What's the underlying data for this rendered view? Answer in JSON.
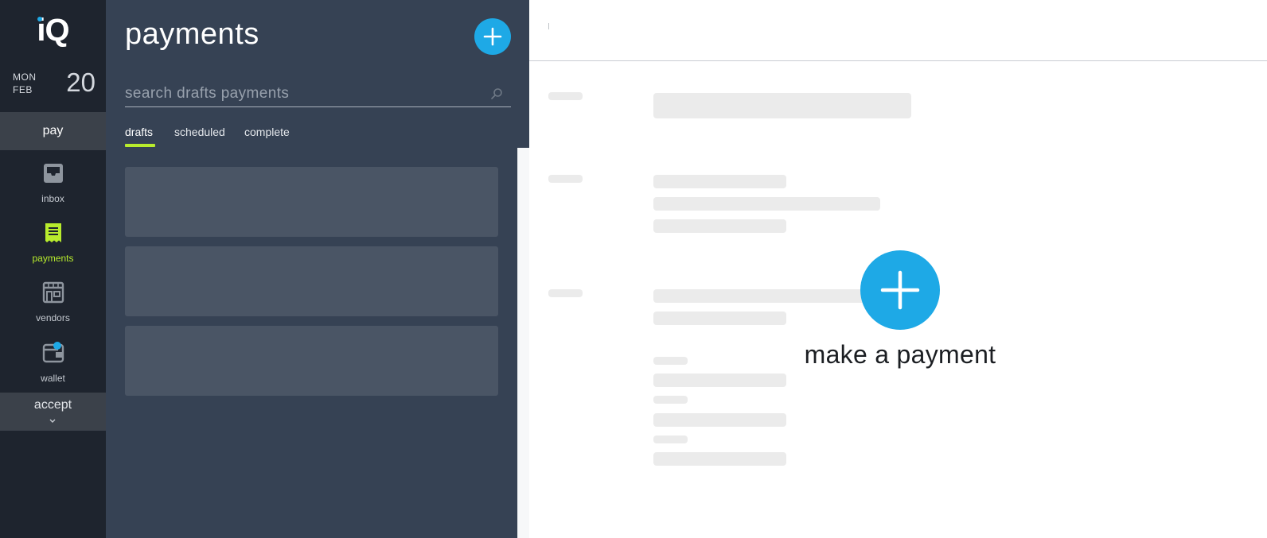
{
  "app": {
    "logo_text": "iQ",
    "date": {
      "weekday": "MON",
      "month": "FEB",
      "day": "20"
    }
  },
  "nav": {
    "pay_section_label": "pay",
    "items": [
      {
        "label": "inbox",
        "icon": "inbox-icon"
      },
      {
        "label": "payments",
        "icon": "receipt-icon",
        "active": true
      },
      {
        "label": "vendors",
        "icon": "storefront-icon"
      },
      {
        "label": "wallet",
        "icon": "wallet-icon"
      }
    ],
    "accept_section_label": "accept"
  },
  "list_panel": {
    "title": "payments",
    "search_placeholder": "search drafts payments",
    "tabs": [
      {
        "label": "drafts",
        "active": true
      },
      {
        "label": "scheduled"
      },
      {
        "label": "complete"
      }
    ]
  },
  "detail": {
    "make_payment_label": "make a payment"
  },
  "colors": {
    "accent_blue": "#1ea9e6",
    "active_green": "#b8ec2d",
    "rail_bg": "#1e242e",
    "panel_bg": "#364254"
  }
}
